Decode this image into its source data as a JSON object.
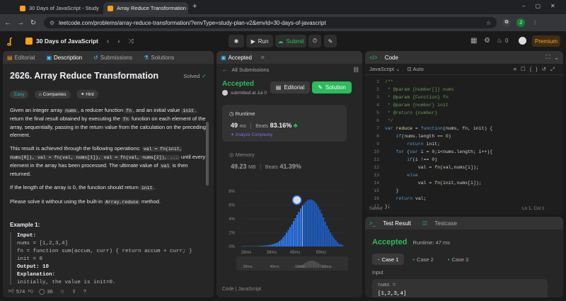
{
  "browser": {
    "tabs": [
      {
        "title": "30 Days of JavaScript - Study P",
        "active": false
      },
      {
        "title": "Array Reduce Transformation - L",
        "active": true
      }
    ],
    "new_tab": "+",
    "url": "leetcode.com/problems/array-reduce-transformation/?envType=study-plan-v2&envId=30-days-of-javascript",
    "profile_initial": "J"
  },
  "header": {
    "study_plan": "30 Days of JavaScript",
    "run": "Run",
    "submit": "Submit",
    "streak": "0",
    "premium": "Premium"
  },
  "problem": {
    "tabs": [
      "Editorial",
      "Description",
      "Submissions",
      "Solutions"
    ],
    "active_tab": "Description",
    "title": "2626. Array Reduce Transformation",
    "status": "Solved",
    "difficulty": "Easy",
    "companies": "Companies",
    "hint": "Hint",
    "para1_a": "Given an integer array ",
    "para1_code1": "nums",
    "para1_b": ", a reducer function ",
    "para1_code2": "fn",
    "para1_c": ", and an initial value ",
    "para1_code3": "init",
    "para1_d": ", return the final result obtained by executing the ",
    "para1_code4": "fn",
    "para1_e": " function on each element of the array, sequentially, passing in the return value from the calculation on the preceding element.",
    "para2_a": "This result is achieved through the following operations: ",
    "para2_code1": "val = fn(init, nums[0]), val = fn(val, nums[1]), val = fn(val, nums[2]), ...",
    "para2_b": " until every element in the array has been processed. The ultimate value of ",
    "para2_code2": "val",
    "para2_c": " is then returned.",
    "para3_a": "If the length of the array is 0, the function should return ",
    "para3_code": "init",
    "para3_b": ".",
    "para4_a": "Please solve it without using the built-in ",
    "para4_code": "Array.reduce",
    "para4_b": " method.",
    "example_title": "Example 1:",
    "example_lines": [
      "Input:",
      "nums = [1,2,3,4]",
      "fn = function sum(accum, curr) { return accum + curr; }",
      "init = 0",
      "Output: 10",
      "Explanation:",
      "initially, the value is init=0."
    ],
    "likes": "574",
    "comments": "36"
  },
  "submission": {
    "tab": "Accepted",
    "back": "All Submissions",
    "status": "Accepted",
    "submitted": "submitted at Jul 0",
    "editorial": "Editorial",
    "solution": "Solution",
    "runtime_label": "Runtime",
    "runtime_value": "49",
    "runtime_unit": "ms",
    "beats_label": "Beats",
    "runtime_beats": "83.16%",
    "analyze": "Analyze Complexity",
    "memory_label": "Memory",
    "memory_value": "49.23",
    "memory_unit": "MB",
    "memory_beats": "41.39%",
    "y_ticks": [
      "8%",
      "6%",
      "4%",
      "2%",
      "0%"
    ],
    "x_ticks": [
      "26ms",
      "39ms",
      "49ms",
      "59ms"
    ],
    "mini_ticks": [
      "38ms",
      "49ms",
      "59ms",
      "69ms"
    ],
    "footer": "Code | JavaScript"
  },
  "chart_data": {
    "type": "bar",
    "title": "",
    "ylabel": "",
    "ylim": [
      0,
      8
    ],
    "x_ticks": [
      "26ms",
      "39ms",
      "49ms",
      "59ms"
    ],
    "values": [
      0.05,
      0.05,
      0.05,
      0.05,
      0.05,
      0.05,
      0.05,
      0.05,
      0.05,
      0.05,
      0.1,
      0.1,
      0.1,
      0.15,
      0.15,
      0.2,
      0.25,
      0.3,
      0.4,
      0.5,
      0.6,
      0.8,
      1.0,
      1.3,
      1.6,
      2.0,
      2.4,
      2.8,
      3.2,
      3.7,
      4.1,
      4.6,
      5.0,
      5.5,
      5.9,
      6.2,
      6.5,
      6.7,
      6.8,
      6.8,
      6.7,
      6.5,
      6.2,
      5.8,
      5.3,
      4.8,
      4.2,
      3.6,
      3.0,
      2.5,
      2.0,
      1.6,
      1.2,
      0.9,
      0.6,
      0.4,
      0.3,
      0.2
    ],
    "highlight_index": 34
  },
  "editor": {
    "title": "Code",
    "language": "JavaScript",
    "auto": "Auto",
    "lines": [
      "/**",
      " * @param {number[]} nums",
      " * @param {Function} fn",
      " * @param {number} init",
      " * @return {number}",
      " */",
      "var reduce = function(nums, fn, init) {",
      "    if(nums.length == 0)",
      "        return init;",
      "    for (var i = 0;i<nums.length; i++){",
      "        if(i !== 0)",
      "            val = fn(val,nums[i]);",
      "        else",
      "            val = fn(init,nums[i]);",
      "    }",
      "    return val;",
      "};"
    ],
    "saved": "Saved",
    "cursor": "Ln 1, Col 1"
  },
  "results": {
    "tab_result": "Test Result",
    "tab_case": "Testcase",
    "status": "Accepted",
    "runtime": "Runtime: 47 ms",
    "cases": [
      "Case 1",
      "Case 2",
      "Case 3"
    ],
    "input_label": "Input",
    "input_name": "nums =",
    "input_value": "[1,2,3,4]"
  }
}
